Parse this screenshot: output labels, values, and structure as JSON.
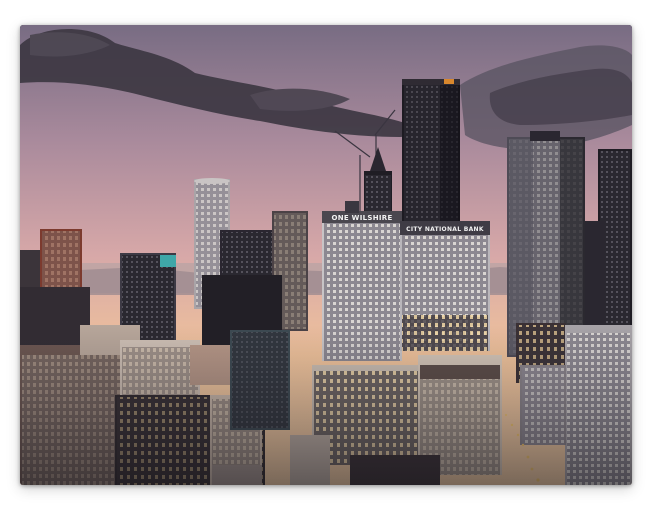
{
  "photo": {
    "signs": {
      "wilshire": "ONE WILSHIRE",
      "bank": "CITY NATIONAL BANK"
    },
    "colors": {
      "sky_top": "#7a6d84",
      "sky_mid": "#c99aa6",
      "sky_low": "#f1c59c",
      "cloud": "#3d3843",
      "building_dark": "#1d1b22",
      "window_light": "#f4d9a0"
    }
  }
}
